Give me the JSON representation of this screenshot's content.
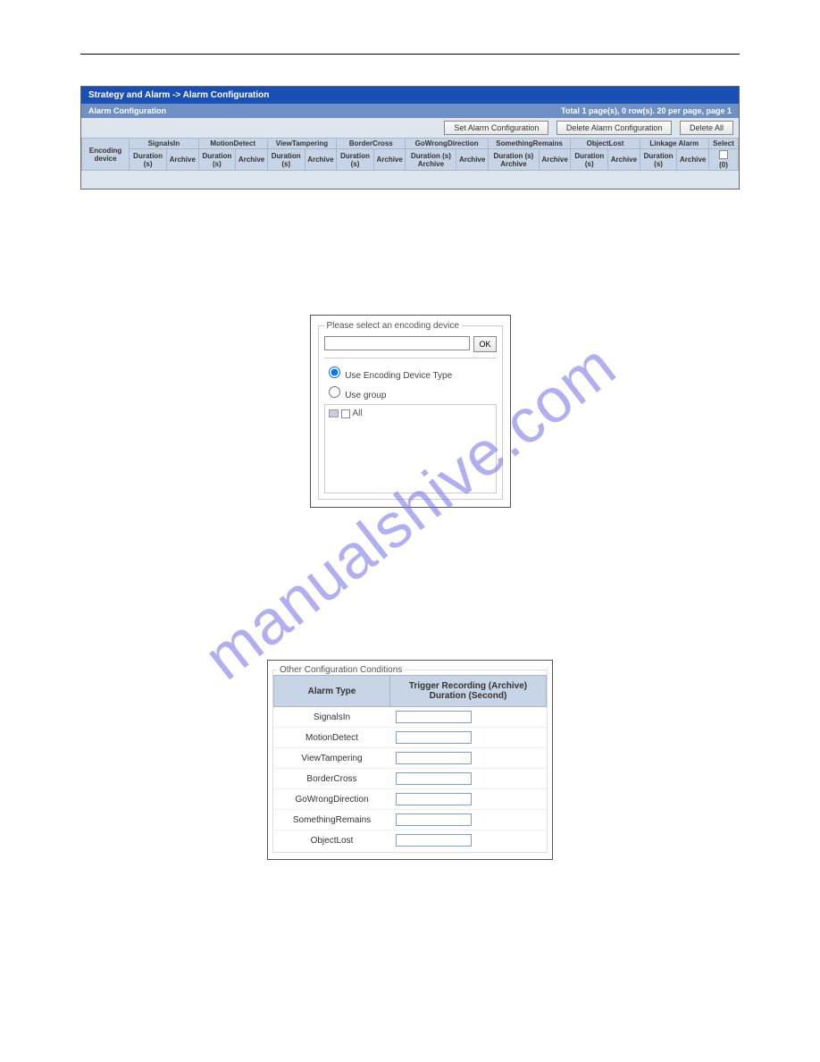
{
  "watermark": "manualshive.com",
  "panel1": {
    "title": "Strategy and Alarm -> Alarm Configuration",
    "subbar_left": "Alarm Configuration",
    "subbar_right": "Total 1 page(s), 0 row(s). 20 per page, page 1",
    "btn_set": "Set Alarm Configuration",
    "btn_delete": "Delete Alarm Configuration",
    "btn_delete_all": "Delete All",
    "enc_header": "Encoding device",
    "dur_label": "Duration (s)",
    "arc_label": "Archive",
    "durs_label": "Duration (s) Archive",
    "select_header": "Select",
    "select_count": "(0)",
    "groups": [
      "SignalsIn",
      "MotionDetect",
      "ViewTampering",
      "BorderCross",
      "GoWrongDirection",
      "SomethingRemains",
      "ObjectLost",
      "Linkage Alarm"
    ]
  },
  "panel2": {
    "legend": "Please select an encoding device",
    "ok": "OK",
    "radio1": "Use Encoding Device Type",
    "radio2": "Use group",
    "all": "All"
  },
  "panel3": {
    "legend": "Other Configuration Conditions",
    "col1": "Alarm Type",
    "col2": "Trigger Recording (Archive) Duration (Second)",
    "rows": [
      "SignalsIn",
      "MotionDetect",
      "ViewTampering",
      "BorderCross",
      "GoWrongDirection",
      "SomethingRemains",
      "ObjectLost"
    ]
  }
}
